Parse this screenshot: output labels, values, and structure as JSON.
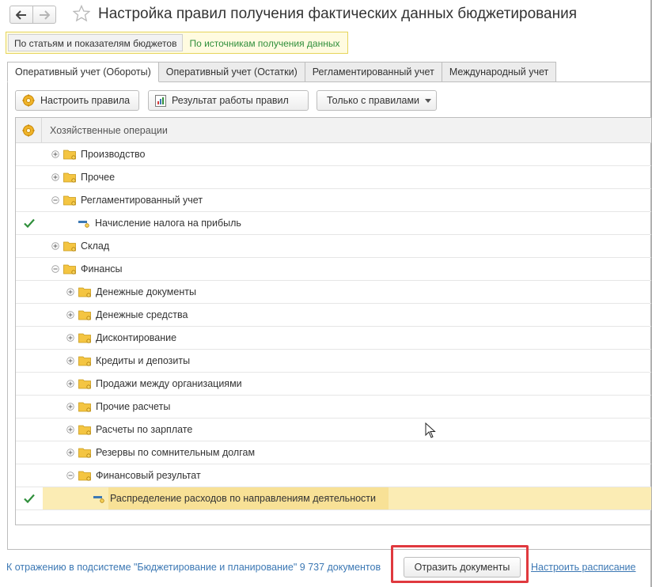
{
  "window": {
    "title": "Настройка правил получения фактических данных бюджетирования"
  },
  "mode_switch": [
    {
      "label": "По статьям и показателям бюджетов",
      "active": false
    },
    {
      "label": "По источникам получения данных",
      "active": true
    }
  ],
  "tabs": [
    {
      "label": "Оперативный учет (Обороты)",
      "active": true
    },
    {
      "label": "Оперативный учет (Остатки)",
      "active": false
    },
    {
      "label": "Регламентированный учет",
      "active": false
    },
    {
      "label": "Международный учет",
      "active": false
    }
  ],
  "toolbar": {
    "configure_label": "Настроить правила",
    "result_label": "Результат работы правил",
    "filter_label": "Только с правилами"
  },
  "table": {
    "header": "Хозяйственные операции",
    "check_mark": "✓",
    "rows": [
      {
        "label": "Производство",
        "level": 0,
        "kind": "group",
        "expand": "plus",
        "checked": false
      },
      {
        "label": "Прочее",
        "level": 0,
        "kind": "group",
        "expand": "plus",
        "checked": false
      },
      {
        "label": "Регламентированный учет",
        "level": 0,
        "kind": "group",
        "expand": "minus",
        "checked": false
      },
      {
        "label": "Начисление налога на прибыль",
        "level": 1,
        "kind": "item",
        "checked": true
      },
      {
        "label": "Склад",
        "level": 0,
        "kind": "group",
        "expand": "plus",
        "checked": false
      },
      {
        "label": "Финансы",
        "level": 0,
        "kind": "group",
        "expand": "minus",
        "checked": false
      },
      {
        "label": "Денежные документы",
        "level": 1,
        "kind": "group",
        "expand": "plus",
        "checked": false
      },
      {
        "label": "Денежные средства",
        "level": 1,
        "kind": "group",
        "expand": "plus",
        "checked": false
      },
      {
        "label": "Дисконтирование",
        "level": 1,
        "kind": "group",
        "expand": "plus",
        "checked": false
      },
      {
        "label": "Кредиты и депозиты",
        "level": 1,
        "kind": "group",
        "expand": "plus",
        "checked": false
      },
      {
        "label": "Продажи между организациями",
        "level": 1,
        "kind": "group",
        "expand": "plus",
        "checked": false
      },
      {
        "label": "Прочие расчеты",
        "level": 1,
        "kind": "group",
        "expand": "plus",
        "checked": false
      },
      {
        "label": "Расчеты по зарплате",
        "level": 1,
        "kind": "group",
        "expand": "plus",
        "checked": false
      },
      {
        "label": "Резервы по сомнительным долгам",
        "level": 1,
        "kind": "group",
        "expand": "plus",
        "checked": false
      },
      {
        "label": "Финансовый результат",
        "level": 1,
        "kind": "group",
        "expand": "minus",
        "checked": false
      },
      {
        "label": "Распределение расходов по направлениям деятельности",
        "level": 2,
        "kind": "item",
        "checked": true,
        "selected": true
      }
    ]
  },
  "footer": {
    "status_text": "К отражению в подсистеме \"Бюджетирование и планирование\" 9 737 документов",
    "post_label": "Отразить документы",
    "schedule_label": "Настроить расписание"
  },
  "colors": {
    "accent_green": "#2f8f3b",
    "link_blue": "#3c78b4",
    "selection": "#fbecb4",
    "highlight_box": "#e0393e",
    "folder": "#f4c542"
  }
}
